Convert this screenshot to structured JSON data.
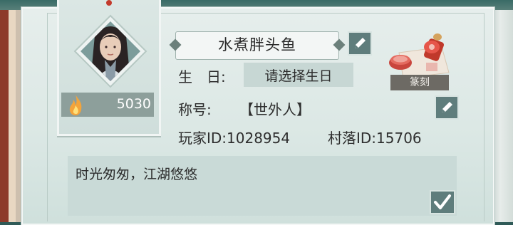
{
  "profile": {
    "name": "水煮胖头鱼",
    "score": "5030",
    "birthday_label": "生　日:",
    "birthday_value": "请选择生日",
    "title_label": "称号:",
    "title_value": "【世外人】",
    "player_id": "玩家ID:1028954",
    "village_id": "村落ID:15706",
    "seal_label": "篆刻",
    "signature": "时光匆匆，江湖悠悠"
  },
  "icons": {
    "edit": "pencil-icon",
    "confirm": "checkmark-icon",
    "score": "flame-icon",
    "seal": "seal-stamp-icon"
  },
  "colors": {
    "button": "#5f7d7c",
    "panel": "#dce8e5",
    "input": "#c7d7d4",
    "score_bg": "#8d9f9b"
  }
}
